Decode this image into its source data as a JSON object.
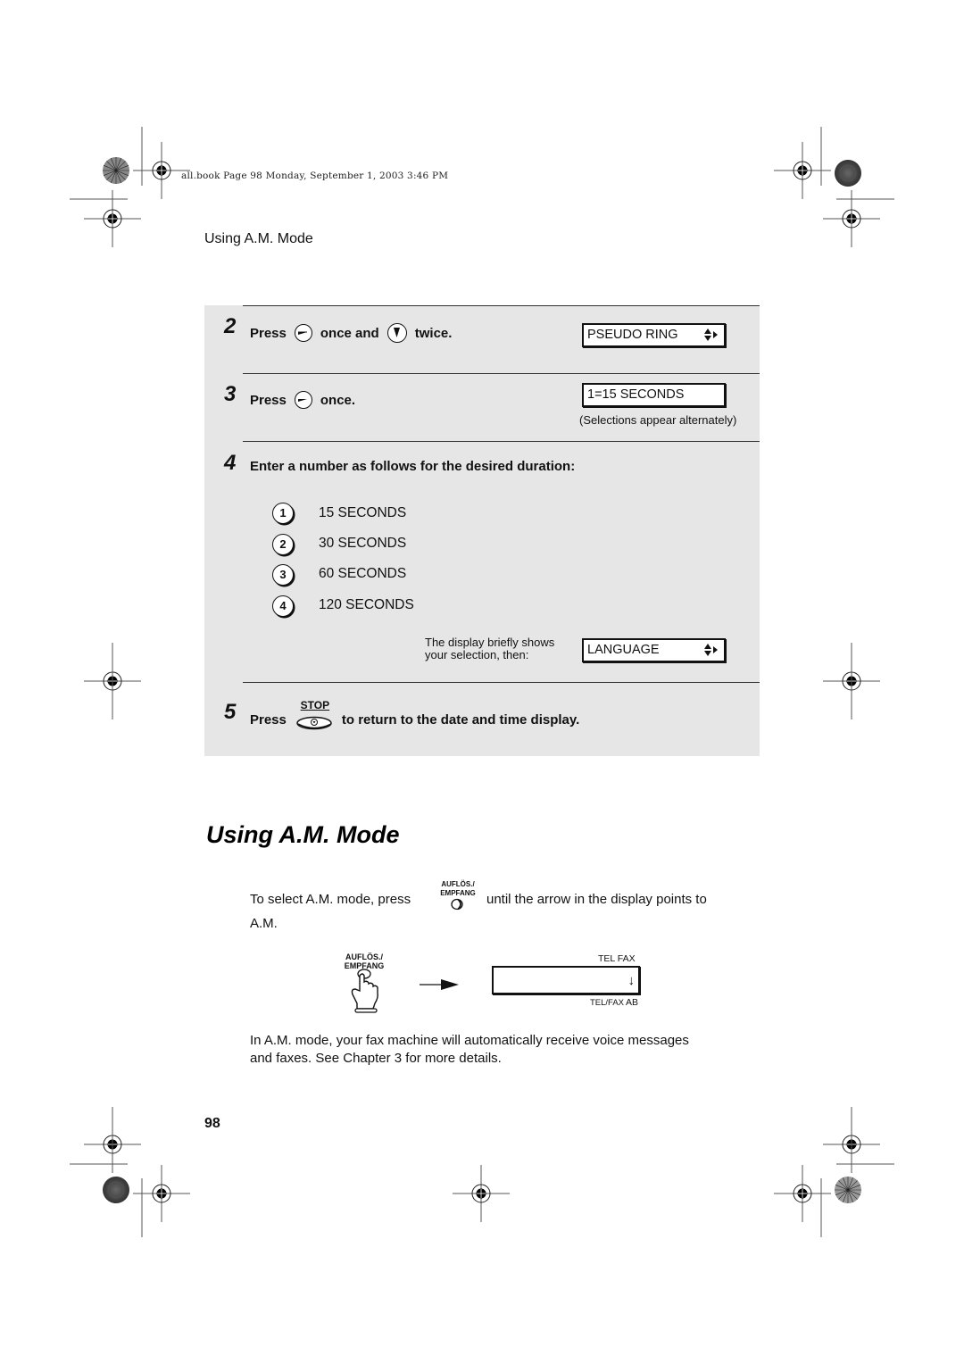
{
  "header_stamp": "all.book  Page 98  Monday, September 1, 2003  3:46 PM",
  "running_head": "Using A.M. Mode",
  "steps": [
    {
      "number": "2",
      "parts": [
        "Press",
        "once and",
        "twice."
      ],
      "buttons": [
        "right-arrow-button",
        "down-arrow-button"
      ],
      "display": "PSEUDO RING"
    },
    {
      "number": "3",
      "parts": [
        "Press",
        "once."
      ],
      "buttons": [
        "right-arrow-button"
      ],
      "display": "1=15 SECONDS",
      "note": "(Selections appear alternately)"
    },
    {
      "number": "4",
      "text": "Enter a number as follows for the desired duration:",
      "options": [
        {
          "key": "1",
          "label": "15 SECONDS"
        },
        {
          "key": "2",
          "label": "30 SECONDS"
        },
        {
          "key": "3",
          "label": "60 SECONDS"
        },
        {
          "key": "4",
          "label": "120 SECONDS"
        }
      ],
      "note_line1": "The display briefly shows",
      "note_line2": "your selection, then:",
      "display": "LANGUAGE"
    },
    {
      "number": "5",
      "parts": [
        "Press",
        "to return to the date and time display."
      ],
      "button_label": "STOP"
    }
  ],
  "section": {
    "title": "Using A.M. Mode",
    "intro_before": "To select A.M. mode, press",
    "intro_after": "until the arrow in the display points to",
    "intro_line2": "A.M.",
    "key_label_line1": "AUFLÖS./",
    "key_label_line2": "EMPFANG",
    "display_top_label": "TEL  FAX",
    "display_bottom_label_left": "TEL/FAX",
    "display_bottom_label_right": "AB",
    "display_arrow": "↓",
    "paragraph_line1": "In A.M. mode, your fax machine will automatically receive voice messages",
    "paragraph_line2": "and faxes. See Chapter 3 for more details."
  },
  "page_number": "98"
}
